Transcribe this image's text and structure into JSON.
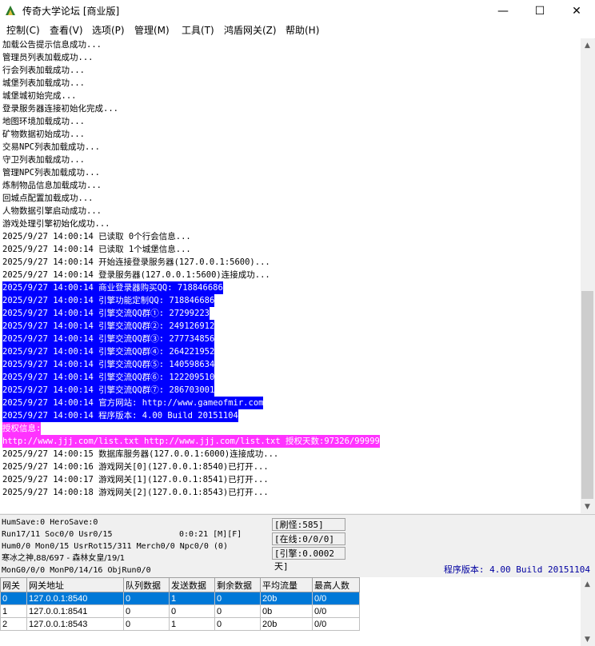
{
  "window": {
    "title": "传奇大学论坛 [商业版]",
    "minimize": "—",
    "maximize": "☐",
    "close": "✕"
  },
  "menu": [
    "控制(C)",
    "查看(V)",
    "选项(P)",
    "管理(M)",
    "工具(T)",
    "鸿盾网关(Z)",
    "帮助(H)"
  ],
  "log": [
    {
      "text": "加载公告提示信息成功...",
      "style": "normal"
    },
    {
      "text": "管理员列表加载成功...",
      "style": "normal"
    },
    {
      "text": "行会列表加载成功...",
      "style": "normal"
    },
    {
      "text": "城堡列表加载成功...",
      "style": "normal"
    },
    {
      "text": "城堡城初始完成...",
      "style": "normal"
    },
    {
      "text": "登录服务器连接初始化完成...",
      "style": "normal"
    },
    {
      "text": "地图环境加载成功...",
      "style": "normal"
    },
    {
      "text": "矿物数据初始成功...",
      "style": "normal"
    },
    {
      "text": "交易NPC列表加载成功...",
      "style": "normal"
    },
    {
      "text": "守卫列表加载成功...",
      "style": "normal"
    },
    {
      "text": "管理NPC列表加载成功...",
      "style": "normal"
    },
    {
      "text": "炼制物品信息加载成功...",
      "style": "normal"
    },
    {
      "text": "回城点配置加载成功...",
      "style": "normal"
    },
    {
      "text": "人物数据引擎启动成功...",
      "style": "normal"
    },
    {
      "text": "游戏处理引擎初始化成功...",
      "style": "normal"
    },
    {
      "text": "2025/9/27 14:00:14 已读取 0个行会信息...",
      "style": "normal"
    },
    {
      "text": "2025/9/27 14:00:14 已读取 1个城堡信息...",
      "style": "normal"
    },
    {
      "text": "2025/9/27 14:00:14 开始连接登录服务器(127.0.0.1:5600)...",
      "style": "normal"
    },
    {
      "text": "2025/9/27 14:00:14 登录服务器(127.0.0.1:5600)连接成功...",
      "style": "normal"
    },
    {
      "text": "2025/9/27 14:00:14 商业登录器购买QQ: 718846686",
      "style": "sel"
    },
    {
      "text": "2025/9/27 14:00:14 引擎功能定制QQ: 718846686",
      "style": "sel"
    },
    {
      "text": "2025/9/27 14:00:14 引擎交流QQ群①: 27299223",
      "style": "sel"
    },
    {
      "text": "2025/9/27 14:00:14 引擎交流QQ群②: 249126912",
      "style": "sel"
    },
    {
      "text": "2025/9/27 14:00:14 引擎交流QQ群③: 277734856",
      "style": "sel"
    },
    {
      "text": "2025/9/27 14:00:14 引擎交流QQ群④: 264221952",
      "style": "sel"
    },
    {
      "text": "2025/9/27 14:00:14 引擎交流QQ群⑤: 140598634",
      "style": "sel"
    },
    {
      "text": "2025/9/27 14:00:14 引擎交流QQ群⑥: 122209510",
      "style": "sel"
    },
    {
      "text": "2025/9/27 14:00:14 引擎交流QQ群⑦: 286703001",
      "style": "sel"
    },
    {
      "text": "2025/9/27 14:00:14 官方网站: http://www.gameofmir.com",
      "style": "sel"
    },
    {
      "text": "2025/9/27 14:00:14 程序版本: 4.00 Build 20151104",
      "style": "sel"
    },
    {
      "text": "授权信息:",
      "style": "mag"
    },
    {
      "text": "http://www.jjj.com/list.txt http://www.jjj.com/list.txt 授权天数:97326/99999",
      "style": "mag"
    },
    {
      "text": "2025/9/27 14:00:15 数据库服务器(127.0.0.1:6000)连接成功...",
      "style": "normal"
    },
    {
      "text": "2025/9/27 14:00:16 游戏网关[0](127.0.0.1:8540)已打开...",
      "style": "normal"
    },
    {
      "text": "2025/9/27 14:00:17 游戏网关[1](127.0.0.1:8541)已打开...",
      "style": "normal"
    },
    {
      "text": "2025/9/27 14:00:18 游戏网关[2](127.0.0.1:8543)已打开...",
      "style": "normal"
    }
  ],
  "status": {
    "line1": "HumSave:0 HeroSave:0",
    "line2": "Run17/11 Soc0/0 Usr0/15",
    "timer": "0:0:21 [M][F]",
    "line3": "Hum0/0 Mon0/15 UsrRot15/311 Merch0/0 Npc0/0 (0)",
    "line4": "寒冰之神,88/697 - 森林女皇/19/1",
    "line5": "MonG0/0/0 MonP0/14/16 ObjRun0/0",
    "refresh": "[刷怪:585]",
    "online": "[在线:0/0/0]",
    "engine": "[引擎:0.0002天]",
    "version": "程序版本: 4.00 Build 20151104"
  },
  "grid": {
    "headers": [
      "网关",
      "网关地址",
      "队列数据",
      "发送数据",
      "剩余数据",
      "平均流量",
      "最高人数"
    ],
    "rows": [
      [
        "0",
        "127.0.0.1:8540",
        "0",
        "1",
        "0",
        "20b",
        "0/0"
      ],
      [
        "1",
        "127.0.0.1:8541",
        "0",
        "0",
        "0",
        "0b",
        "0/0"
      ],
      [
        "2",
        "127.0.0.1:8543",
        "0",
        "1",
        "0",
        "20b",
        "0/0"
      ]
    ]
  },
  "colors": {
    "selection": "#0000ff",
    "license": "#ff33ff",
    "row_selected": "#0078d7",
    "version_text": "#0000a0"
  }
}
